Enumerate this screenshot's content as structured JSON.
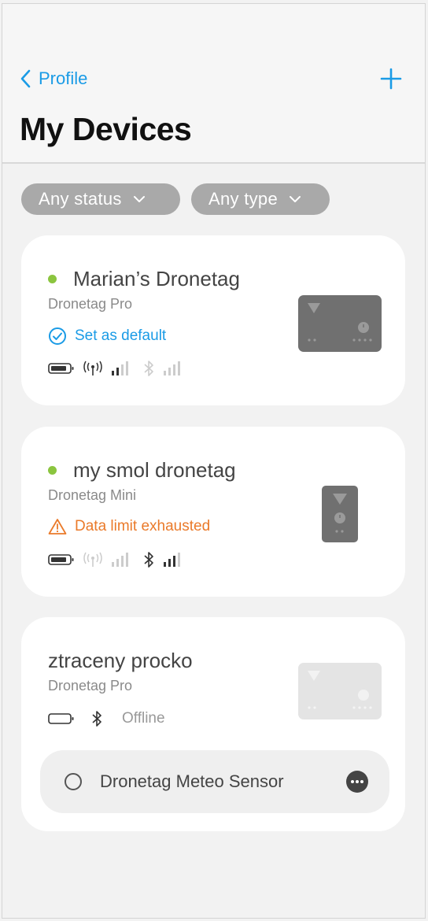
{
  "nav": {
    "back_label": "Profile",
    "title": "My Devices"
  },
  "filters": {
    "status": "Any status",
    "type": "Any type"
  },
  "devices": [
    {
      "name": "Marian’s Dronetag",
      "model": "Dronetag Pro",
      "online": true,
      "status_text": "Set as default",
      "status_kind": "default",
      "battery_level": 0.8,
      "cellular_active": true,
      "bluetooth_active": false,
      "image": "dronetag-pro-device"
    },
    {
      "name": "my smol dronetag",
      "model": "Dronetag Mini",
      "online": true,
      "status_text": "Data limit exhausted",
      "status_kind": "warning",
      "battery_level": 0.8,
      "cellular_active": false,
      "bluetooth_active": true,
      "image": "dronetag-mini-device"
    },
    {
      "name": "ztraceny procko",
      "model": "Dronetag Pro",
      "online": false,
      "connection_text": "Offline",
      "battery_level": 0,
      "image": "dronetag-pro-device",
      "accessory": {
        "label": "Dronetag Meteo Sensor",
        "selected": false
      }
    }
  ],
  "colors": {
    "accent": "#1a9be6",
    "online_dot": "#8bc53f",
    "warning": "#ea7a2a",
    "filter_bg": "#a9a9a9",
    "device_body": "#707070"
  },
  "icons": [
    "chevron-left-icon",
    "plus-icon",
    "chevron-down-icon",
    "check-circle-icon",
    "warning-triangle-icon",
    "battery-icon",
    "cellular-antenna-icon",
    "signal-bars-icon",
    "bluetooth-icon",
    "more-icon"
  ]
}
